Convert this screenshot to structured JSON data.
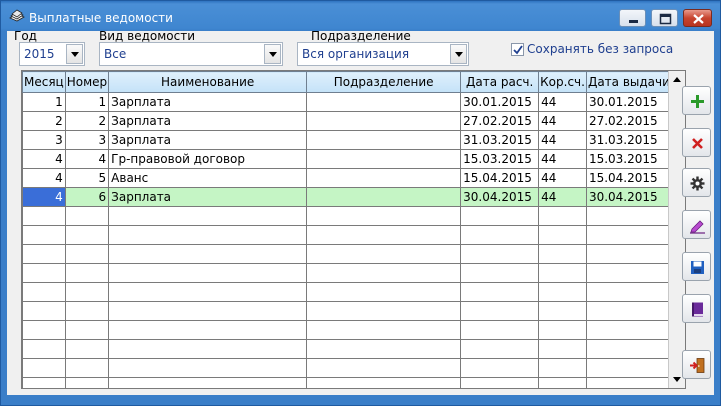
{
  "window": {
    "title": "Выплатные ведомости"
  },
  "filters": {
    "year_label": "Год",
    "year_value": "2015",
    "type_label": "Вид ведомости",
    "type_value": "Все",
    "dept_label": "Подразделение",
    "dept_value": "Вся организация",
    "save_label": "Сохранять без запроса",
    "save_checked": true
  },
  "table": {
    "columns": [
      "Месяц",
      "Номер",
      "Наименование",
      "Подразделение",
      "Дата расч.",
      "Кор.сч.",
      "Дата выдачи"
    ],
    "rows": [
      {
        "month": "1",
        "number": "1",
        "name": "Зарплата",
        "dept": "",
        "calc_date": "30.01.2015",
        "account": "44",
        "pay_date": "30.01.2015"
      },
      {
        "month": "2",
        "number": "2",
        "name": "Зарплата",
        "dept": "",
        "calc_date": "27.02.2015",
        "account": "44",
        "pay_date": "27.02.2015"
      },
      {
        "month": "3",
        "number": "3",
        "name": "Зарплата",
        "dept": "",
        "calc_date": "31.03.2015",
        "account": "44",
        "pay_date": "31.03.2015"
      },
      {
        "month": "4",
        "number": "4",
        "name": "Гр-правовой договор",
        "dept": "",
        "calc_date": "15.03.2015",
        "account": "44",
        "pay_date": "15.03.2015"
      },
      {
        "month": "4",
        "number": "5",
        "name": "Аванс",
        "dept": "",
        "calc_date": "15.04.2015",
        "account": "44",
        "pay_date": "15.04.2015"
      },
      {
        "month": "4",
        "number": "6",
        "name": "Зарплата",
        "dept": "",
        "calc_date": "30.04.2015",
        "account": "44",
        "pay_date": "30.04.2015"
      }
    ],
    "selected_row": 5,
    "empty_rows": 10
  },
  "toolbar": {
    "buttons": [
      {
        "name": "add-button",
        "icon": "plus-icon",
        "color": "#2a9a2a"
      },
      {
        "name": "delete-button",
        "icon": "cross-icon",
        "color": "#d02020"
      },
      {
        "name": "settings-button",
        "icon": "gear-icon",
        "color": "#333333"
      },
      {
        "name": "edit-button",
        "icon": "pencil-icon",
        "color": "#a040c0"
      },
      {
        "name": "save-button",
        "icon": "floppy-icon",
        "color": "#2060c0"
      },
      {
        "name": "book-button",
        "icon": "book-icon",
        "color": "#6a2a9a"
      },
      {
        "name": "exit-button",
        "icon": "door-exit-icon",
        "color": "#c07020"
      }
    ]
  }
}
